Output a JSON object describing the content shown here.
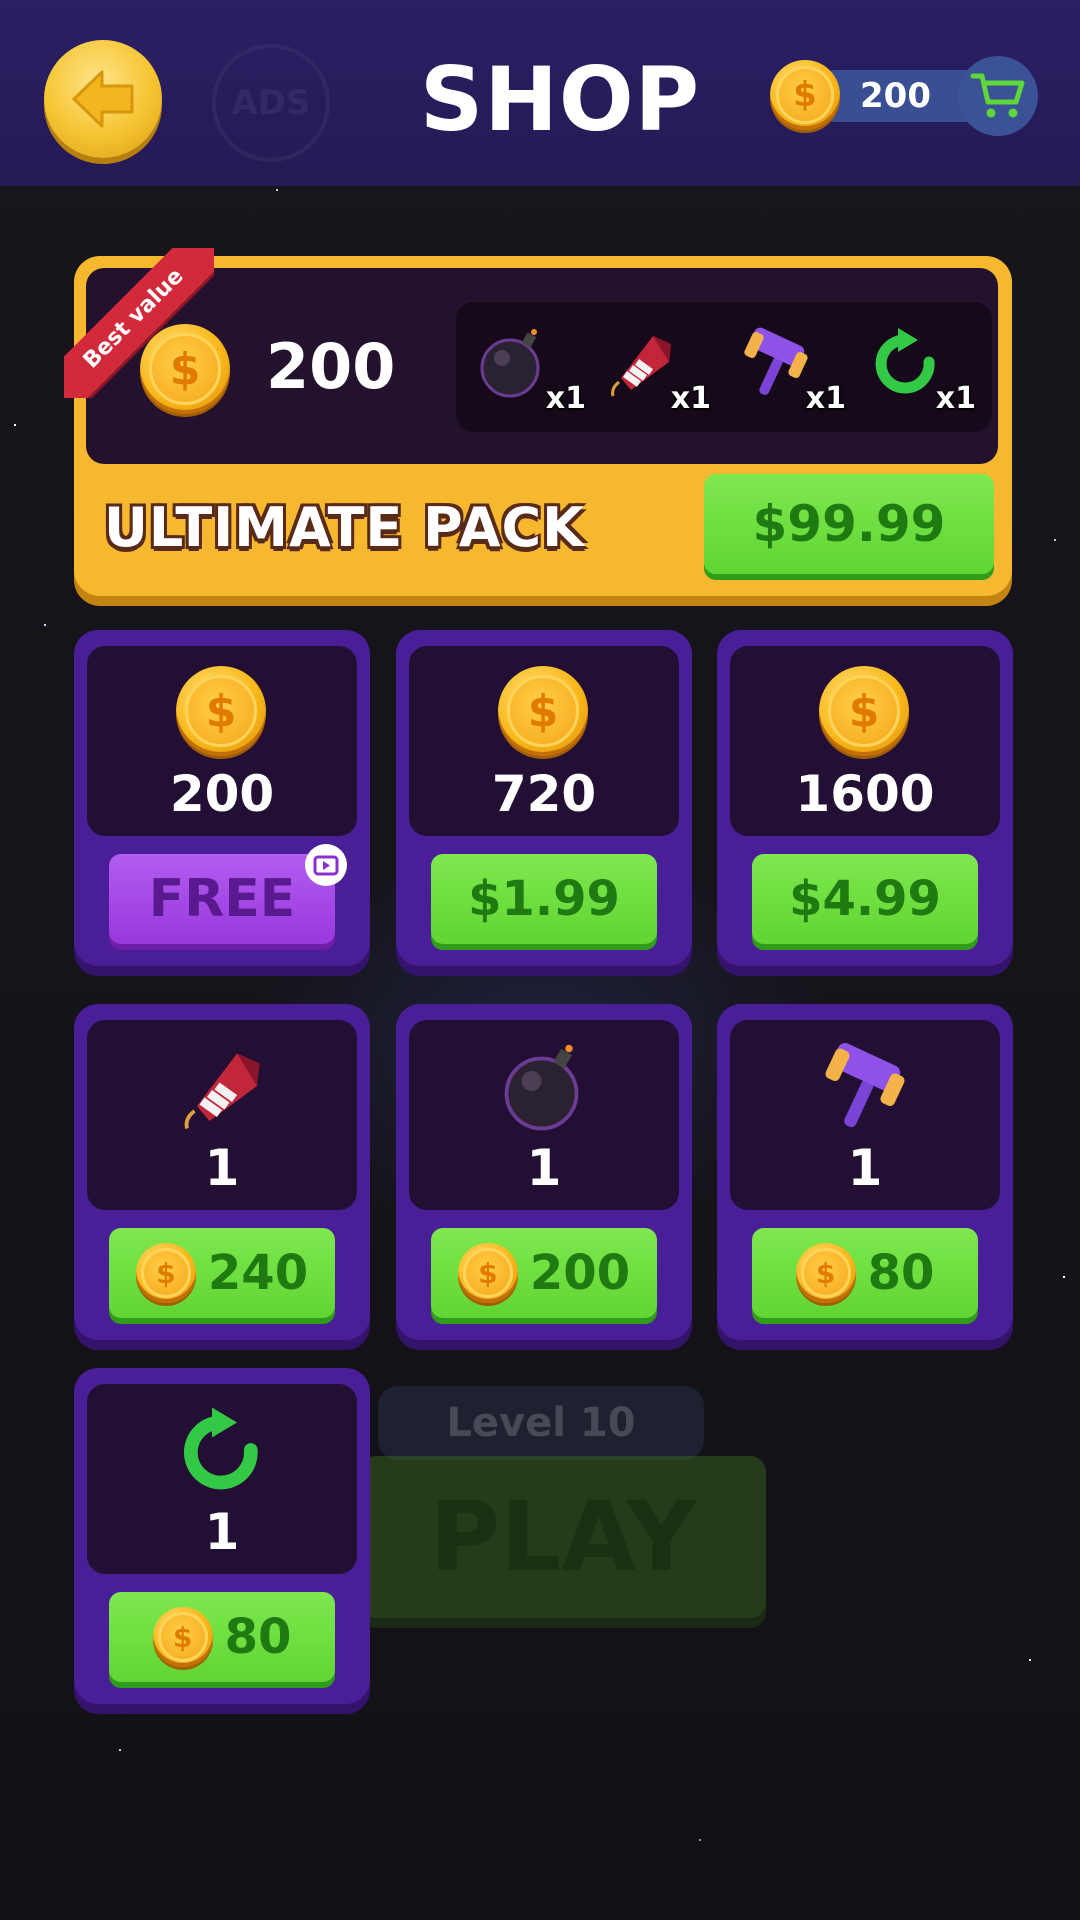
{
  "header": {
    "title": "SHOP",
    "wallet_amount": "200",
    "ads_icon_text": "ADS"
  },
  "ultimate_pack": {
    "ribbon": "Best value",
    "coins": "200",
    "label": "ULTIMATE PACK",
    "price": "$99.99",
    "items": [
      {
        "icon": "bomb-icon",
        "qty": "x1"
      },
      {
        "icon": "rocket-icon",
        "qty": "x1"
      },
      {
        "icon": "hammer-icon",
        "qty": "x1"
      },
      {
        "icon": "refresh-icon",
        "qty": "x1"
      }
    ]
  },
  "coin_offers": [
    {
      "amount": "200",
      "button": "FREE",
      "type": "ad"
    },
    {
      "amount": "720",
      "button": "$1.99",
      "type": "price"
    },
    {
      "amount": "1600",
      "button": "$4.99",
      "type": "price"
    }
  ],
  "booster_offers": [
    {
      "icon": "rocket-icon",
      "amount": "1",
      "cost": "240"
    },
    {
      "icon": "bomb-icon",
      "amount": "1",
      "cost": "200"
    },
    {
      "icon": "hammer-icon",
      "amount": "1",
      "cost": "80"
    },
    {
      "icon": "refresh-icon",
      "amount": "1",
      "cost": "80"
    }
  ],
  "background": {
    "level": "Level 10",
    "play": "PLAY"
  },
  "colors": {
    "header": "#2b1f63",
    "card": "#4a1e96",
    "pack": "#f5b82e",
    "buy_green": "#61d533",
    "free_purple": "#9838dd",
    "ribbon_red": "#d32a3b"
  }
}
